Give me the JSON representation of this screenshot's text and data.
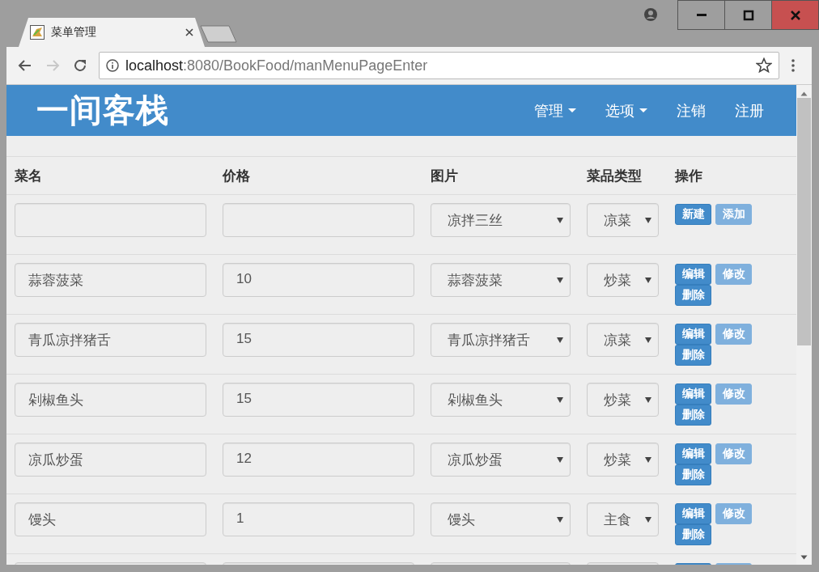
{
  "browser": {
    "tab": {
      "title": "菜单管理"
    },
    "toolbar": [
      {
        "kind": "back",
        "disabled": false
      },
      {
        "kind": "forward",
        "disabled": true
      },
      {
        "kind": "reload",
        "disabled": false
      }
    ],
    "address": {
      "host": "localhost",
      "path": ":8080/BookFood/manMenuPageEnter"
    }
  },
  "navbar": {
    "brand": "一间客栈",
    "items": [
      {
        "label": "管理",
        "dropdown": true
      },
      {
        "label": "选项",
        "dropdown": true
      },
      {
        "label": "注销",
        "dropdown": false
      },
      {
        "label": "注册",
        "dropdown": false
      }
    ]
  },
  "table": {
    "columns": [
      "菜名",
      "价格",
      "图片",
      "菜品类型",
      "操作"
    ],
    "rows": [
      {
        "kind": "new",
        "name": "",
        "price": "",
        "picture": "凉拌三丝",
        "type": "凉菜",
        "actions": [
          {
            "label": "新建",
            "kind": "primary"
          },
          {
            "label": "添加",
            "kind": "light"
          }
        ]
      },
      {
        "kind": "item",
        "name": "蒜蓉菠菜",
        "price": "10",
        "picture": "蒜蓉菠菜",
        "type": "炒菜",
        "actions": [
          {
            "label": "编辑",
            "kind": "primary"
          },
          {
            "label": "修改",
            "kind": "light"
          },
          {
            "label": "删除",
            "kind": "primary"
          }
        ]
      },
      {
        "kind": "item",
        "name": "青瓜凉拌猪舌",
        "price": "15",
        "picture": "青瓜凉拌猪舌",
        "type": "凉菜",
        "actions": [
          {
            "label": "编辑",
            "kind": "primary"
          },
          {
            "label": "修改",
            "kind": "light"
          },
          {
            "label": "删除",
            "kind": "primary"
          }
        ]
      },
      {
        "kind": "item",
        "name": "剁椒鱼头",
        "price": "15",
        "picture": "剁椒鱼头",
        "type": "炒菜",
        "actions": [
          {
            "label": "编辑",
            "kind": "primary"
          },
          {
            "label": "修改",
            "kind": "light"
          },
          {
            "label": "删除",
            "kind": "primary"
          }
        ]
      },
      {
        "kind": "item",
        "name": "凉瓜炒蛋",
        "price": "12",
        "picture": "凉瓜炒蛋",
        "type": "炒菜",
        "actions": [
          {
            "label": "编辑",
            "kind": "primary"
          },
          {
            "label": "修改",
            "kind": "light"
          },
          {
            "label": "删除",
            "kind": "primary"
          }
        ]
      },
      {
        "kind": "item",
        "name": "馒头",
        "price": "1",
        "picture": "馒头",
        "type": "主食",
        "actions": [
          {
            "label": "编辑",
            "kind": "primary"
          },
          {
            "label": "修改",
            "kind": "light"
          },
          {
            "label": "删除",
            "kind": "primary"
          }
        ]
      },
      {
        "kind": "clipped"
      }
    ]
  }
}
